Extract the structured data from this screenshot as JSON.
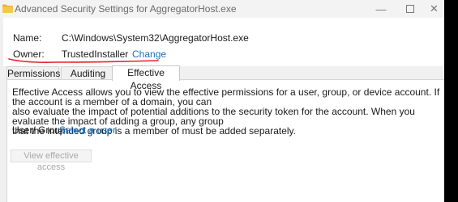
{
  "window": {
    "title": "Advanced Security Settings for AggregatorHost.exe",
    "controls": {
      "minimize": "—",
      "close": "✕"
    }
  },
  "info": {
    "name_label": "Name:",
    "name_value": "C:\\Windows\\System32\\AggregatorHost.exe",
    "owner_label": "Owner:",
    "owner_value": "TrustedInstaller",
    "change_link": "Change"
  },
  "tabs": [
    {
      "label": "Permissions",
      "selected": false
    },
    {
      "label": "Auditing",
      "selected": false
    },
    {
      "label": "Effective Access",
      "selected": true
    }
  ],
  "effective_access": {
    "description_lines": [
      "Effective Access allows you to view the effective permissions for a user, group, or device account. If the account is a member of a domain, you can",
      "also evaluate the impact of potential additions to the security token for the account. When you evaluate the impact of adding a group, any group",
      "that the intended group is a member of must be added separately."
    ],
    "user_group_label": "User/ Group:",
    "select_user_link": "Select a user",
    "view_button": "View effective access"
  },
  "colors": {
    "link": "#1a6fb8",
    "annotation_red": "#e8202a",
    "window_bg": "#f0f0f0",
    "panel_bg": "#ffffff"
  }
}
